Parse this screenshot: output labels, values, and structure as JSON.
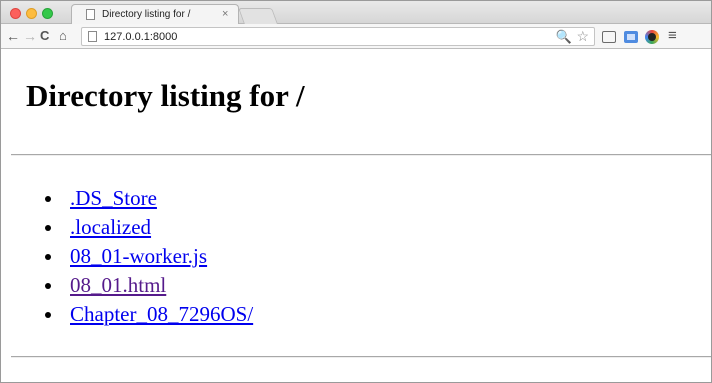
{
  "browser": {
    "tab_title": "Directory listing for /",
    "tab_close": "×",
    "url": "127.0.0.1:8000",
    "nav": {
      "back": "←",
      "forward": "→",
      "reload": "C",
      "home": "⌂"
    },
    "icons": {
      "zoom": "🔍",
      "star": "☆",
      "menu": "≡"
    }
  },
  "page": {
    "heading": "Directory listing for /",
    "files": [
      {
        "name": ".DS_Store",
        "visited": false
      },
      {
        "name": ".localized",
        "visited": false
      },
      {
        "name": "08_01-worker.js",
        "visited": false
      },
      {
        "name": "08_01.html",
        "visited": true
      },
      {
        "name": "Chapter_08_7296OS/",
        "visited": false
      }
    ]
  },
  "colors": {
    "link": "#0000ee",
    "visited_link": "#551a8b"
  }
}
